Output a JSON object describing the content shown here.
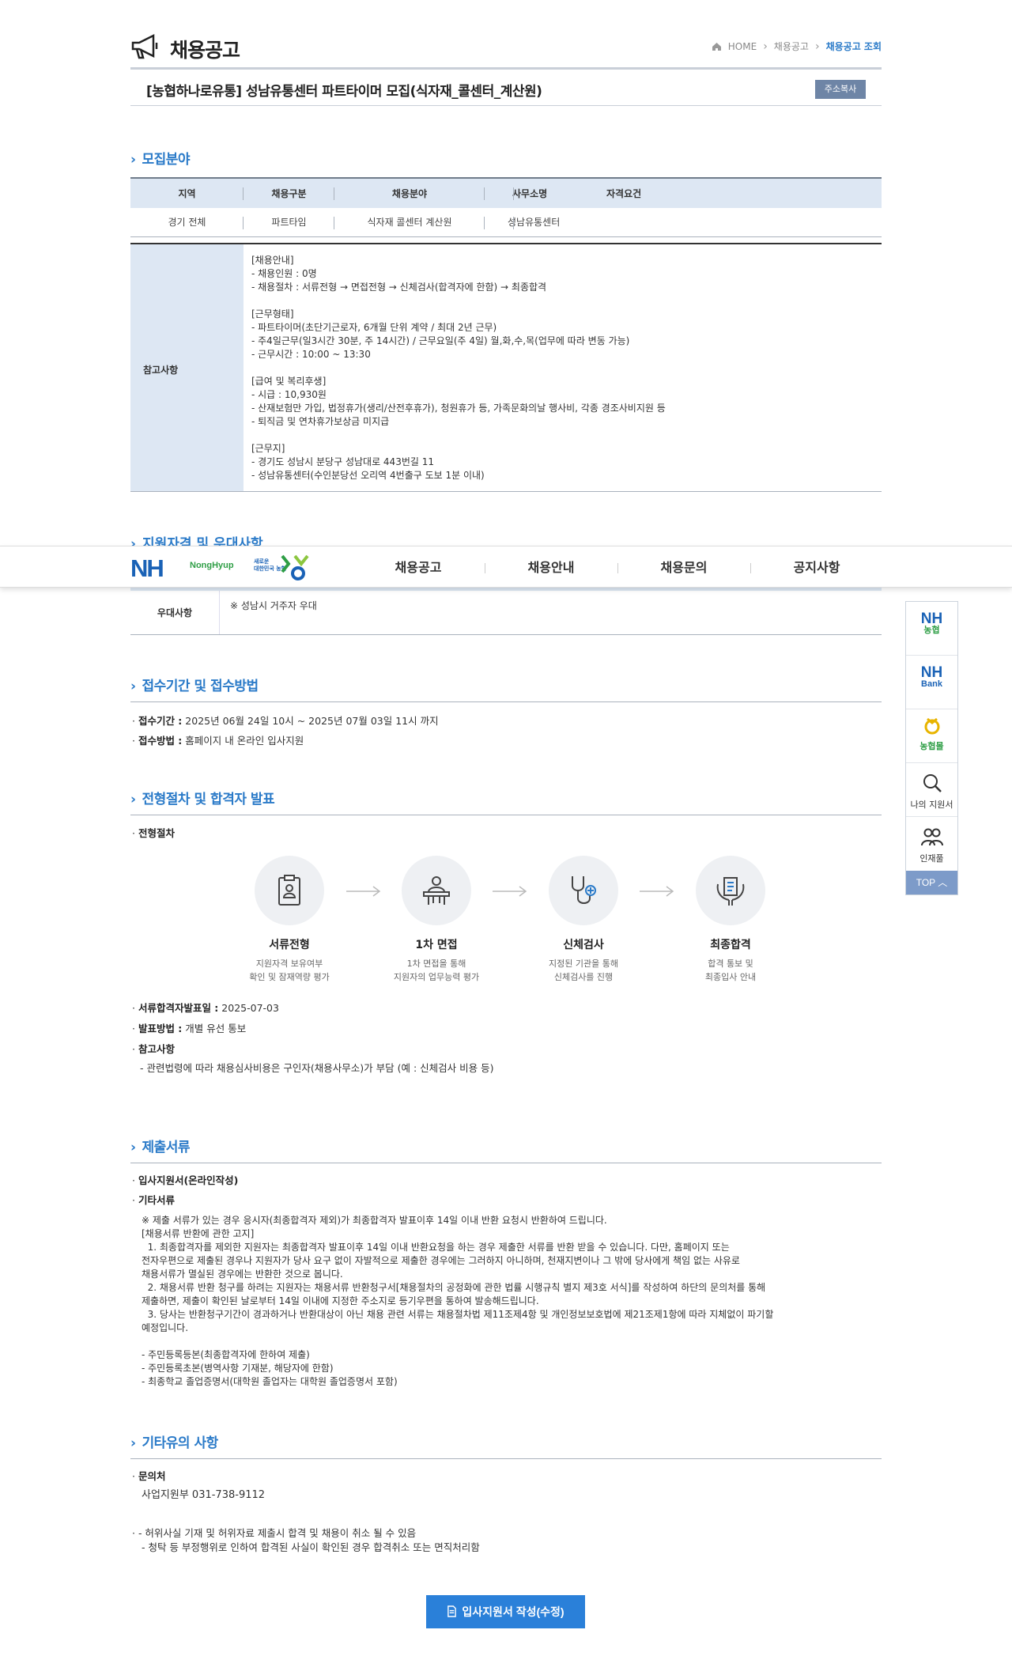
{
  "header": {
    "title": "채용공고",
    "breadcrumb": [
      "HOME",
      "채용공고",
      "채용공고 조회"
    ]
  },
  "job": {
    "title": "[농협하나로유통] 성남유통센터 파트타이머 모집(식자재_콜센터_계산원)",
    "copy_button": "주소복사"
  },
  "recruit": {
    "section_title": "모집분야",
    "headers": [
      "지역",
      "채용구분",
      "채용분야",
      "사무소명",
      "자격요건"
    ],
    "row": [
      "경기 전체",
      "파트타임",
      "식자재 콜센터 계산원",
      "성남유통센터",
      ""
    ],
    "notes_label": "참고사항",
    "notes": "[채용안내]\n- 채용인원 : 0명\n- 채용절차 : 서류전형 → 면접전형 → 신체검사(합격자에 한함) → 최종합격\n\n[근무형태]\n- 파트타이머(초단기근로자, 6개월 단위 계약 / 최대 2년 근무)\n- 주4일근무(일3시간 30분, 주 14시간) / 근무요일(주 4일) 월,화,수,목(업무에 따라 변동 가능)\n- 근무시간 : 10:00 ~ 13:30\n\n[급여 및 복리후생]\n- 시급 : 10,930원\n- 산재보험만 가입, 법정휴가(생리/산전후휴가), 청원휴가 등, 가족문화의날 행사비, 각종 경조사비지원 등\n- 퇴직금 및 연차휴가보상금 미지급\n\n[근무지]\n- 경기도 성남시 분당구 성남대로 443번길 11\n- 성남유통센터(수인분당선 오리역 4번출구 도보 1분 이내)"
  },
  "nav": {
    "logo": "NH",
    "logo_sub": "NongHyup",
    "new_logo_line1": "새로운",
    "new_logo_line2": "대한민국 농협",
    "items": [
      "채용공고",
      "채용안내",
      "채용문의",
      "공지사항"
    ]
  },
  "qualification": {
    "section_title": "지원자격 및 우대사항",
    "pref_label": "우대사항",
    "pref_value": "※ 성남시 거주자 우대"
  },
  "side_menu": {
    "items": [
      {
        "top": "NH",
        "bottom": "농협"
      },
      {
        "top": "NH",
        "bottom": "Bank"
      },
      {
        "top": "",
        "bottom": "농협몰"
      }
    ],
    "my_apply": "나의 지원서",
    "talent": "인재풀",
    "top": "TOP"
  },
  "period": {
    "section_title": "접수기간 및 접수방법",
    "period_label": "접수기간 :",
    "period_value": "2025년 06월 24일 10시 ~ 2025년 07월 03일 11시 까지",
    "method_label": "접수방법 :",
    "method_value": "홈페이지 내 온라인 입사지원"
  },
  "process": {
    "section_title": "전형절차 및 합격자 발표",
    "label": "전형절차",
    "steps": [
      {
        "name": "서류전형",
        "desc1": "지원자격 보유여부",
        "desc2": "확인 및 잠재역량 평가"
      },
      {
        "name": "1차 면접",
        "desc1": "1차 면접을 통해",
        "desc2": "지원자의 업무능력 평가"
      },
      {
        "name": "신체검사",
        "desc1": "지정된 기관을 통해",
        "desc2": "신체검사를 진행"
      },
      {
        "name": "최종합격",
        "desc1": "합격 통보 및",
        "desc2": "최종입사 안내"
      }
    ],
    "announce_label": "서류합격자발표일 :",
    "announce_value": "2025-07-03",
    "ann_method_label": "발표방법 :",
    "ann_method_value": "개별 유선 통보",
    "ref_label": "참고사항",
    "ref_value": "- 관련법령에 따라 채용심사비용은 구인자(채용사무소)가 부담 (예 : 신체검사 비용 등)"
  },
  "documents": {
    "section_title": "제출서류",
    "item1": "입사지원서(온라인작성)",
    "item2": "기타서류",
    "detail": "※ 제출 서류가 있는 경우 응시자(최종합격자 제외)가 최종합격자 발표이후 14일 이내 반환 요청시 반환하여 드립니다.\n[채용서류 반환에 관한 고지]\n  1. 최종합격자를 제외한 지원자는 최종합격자 발표이후 14일 이내 반환요청을 하는 경우 제출한 서류를 반환 받을 수 있습니다. 다만, 홈페이지 또는\n전자우편으로 제출된 경우나 지원자가 당사 요구 없이 자발적으로 제출한 경우에는 그러하지 아니하며, 천재지변이나 그 밖에 당사에게 책임 없는 사유로\n채용서류가 멸실된 경우에는 반환한 것으로 봅니다.\n  2. 채용서류 반환 청구를 하려는 지원자는 채용서류 반환청구서[채용절차의 공정화에 관한 법률 시행규칙 별지 제3호 서식]를 작성하여 하단의 문의처를 통해\n제출하면, 제출이 확인된 날로부터 14일 이내에 지정한 주소지로 등기우편을 통하여 발송해드립니다.\n  3. 당사는 반환청구기간이 경과하거나 반환대상이 아닌 채용 관련 서류는 채용절차법 제11조제4항 및 개인정보보호법에 제21조제1항에 따라 지체없이 파기할\n예정입니다.\n\n- 주민등록등본(최종합격자에 한하여 제출)\n- 주민등록초본(병역사항 기재분, 해당자에 한함)\n- 최종학교 졸업증명서(대학원 졸업자는 대학원 졸업증명서 포함)"
  },
  "etc": {
    "section_title": "기타유의 사항",
    "contact_label": "문의처",
    "contact_value": "사업지원부 031-738-9112",
    "note1": "- 허위사실 기재 및 허위자료 제출시 합격 및 채용이 취소 될 수 있음",
    "note2": "- 청탁 등 부정행위로 인하여 합격된 사실이 확인된 경우 합격취소 또는 면직처리함"
  },
  "apply_button": "입사지원서 작성(수정)"
}
